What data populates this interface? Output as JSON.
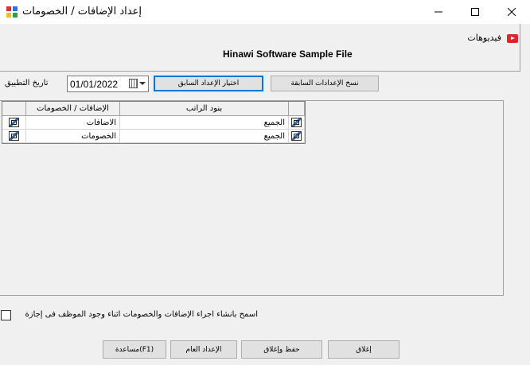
{
  "window": {
    "title": "إعداد الإضافات / الخصومات"
  },
  "header": {
    "videos_label": "فيديوهات",
    "sample_title": "Hinawi Software Sample File"
  },
  "toolbar": {
    "date_label": "تاريخ التطبيق",
    "date_value": "01/01/2022",
    "choose_previous_label": "اختيار الإعداد السابق",
    "copy_previous_label": "نسخ الإعدادات السابقة"
  },
  "grid": {
    "columns": [
      "الإضافات / الخصومات",
      "بنود الراتب"
    ],
    "rows": [
      {
        "type": "الاضافات",
        "item": "الجميع"
      },
      {
        "type": "الخصومات",
        "item": "الجميع"
      }
    ]
  },
  "options": {
    "allow_label": "اسمح بانشاء اجراء الإضافات والخصومات اثناء وجود الموظف فى إجازة",
    "allow_checked": false
  },
  "footer": {
    "help_label": "(F1)مساعدة",
    "general_settings_label": "الإعداد العام",
    "save_close_label": "حفظ وإغلاق",
    "close_label": "إغلاق"
  },
  "icons": {
    "app": "app-icon",
    "video": "video-icon",
    "calendar": "calendar-icon",
    "row": "edit-row-icon"
  },
  "colors": {
    "accent": "#0078d7",
    "video": "#e02626"
  }
}
